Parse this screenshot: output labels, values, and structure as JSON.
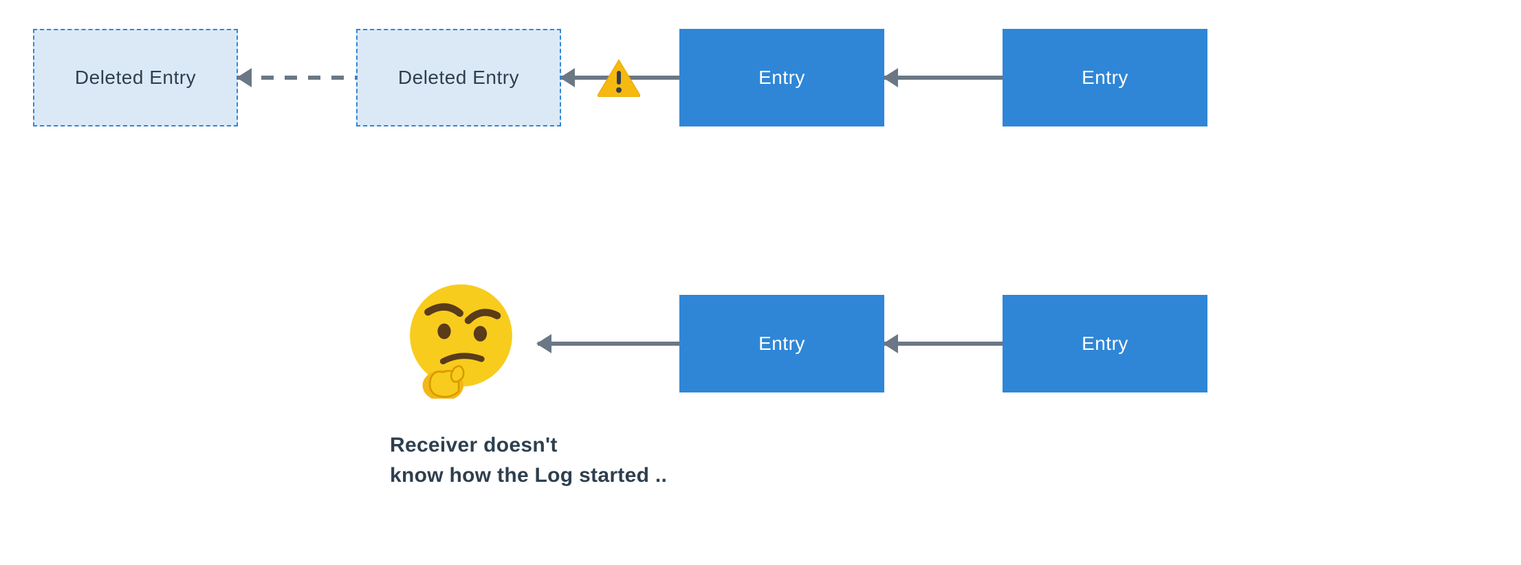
{
  "colors": {
    "entry_fill": "#2f86d6",
    "entry_text": "#ffffff",
    "deleted_fill": "#dbe9f7",
    "deleted_border": "#2f86d6",
    "deleted_text": "#2e3f4e",
    "arrow": "#6b7784",
    "warn_fill": "#f6b關_placeholder"
  },
  "row1": {
    "nodes": [
      {
        "id": "n11",
        "kind": "deleted",
        "label": "Deleted Entry"
      },
      {
        "id": "n12",
        "kind": "deleted",
        "label": "Deleted Entry"
      },
      {
        "id": "n13",
        "kind": "entry",
        "label": "Entry"
      },
      {
        "id": "n14",
        "kind": "entry",
        "label": "Entry"
      }
    ],
    "arrows": [
      {
        "from": "n12",
        "to": "n11",
        "style": "dashed"
      },
      {
        "from": "n13",
        "to": "n12",
        "style": "solid",
        "warning": true
      },
      {
        "from": "n14",
        "to": "n13",
        "style": "solid"
      }
    ]
  },
  "row2": {
    "receiver_icon": "thinking-face",
    "nodes": [
      {
        "id": "n23",
        "kind": "entry",
        "label": "Entry"
      },
      {
        "id": "n24",
        "kind": "entry",
        "label": "Entry"
      }
    ],
    "arrows": [
      {
        "from": "n23",
        "to": "receiver",
        "style": "solid"
      },
      {
        "from": "n24",
        "to": "n23",
        "style": "solid"
      }
    ],
    "caption": "Receiver doesn't\nknow how the Log started .."
  },
  "icons": {
    "warning": "warning-triangle-icon",
    "thinking": "thinking-face-icon"
  }
}
